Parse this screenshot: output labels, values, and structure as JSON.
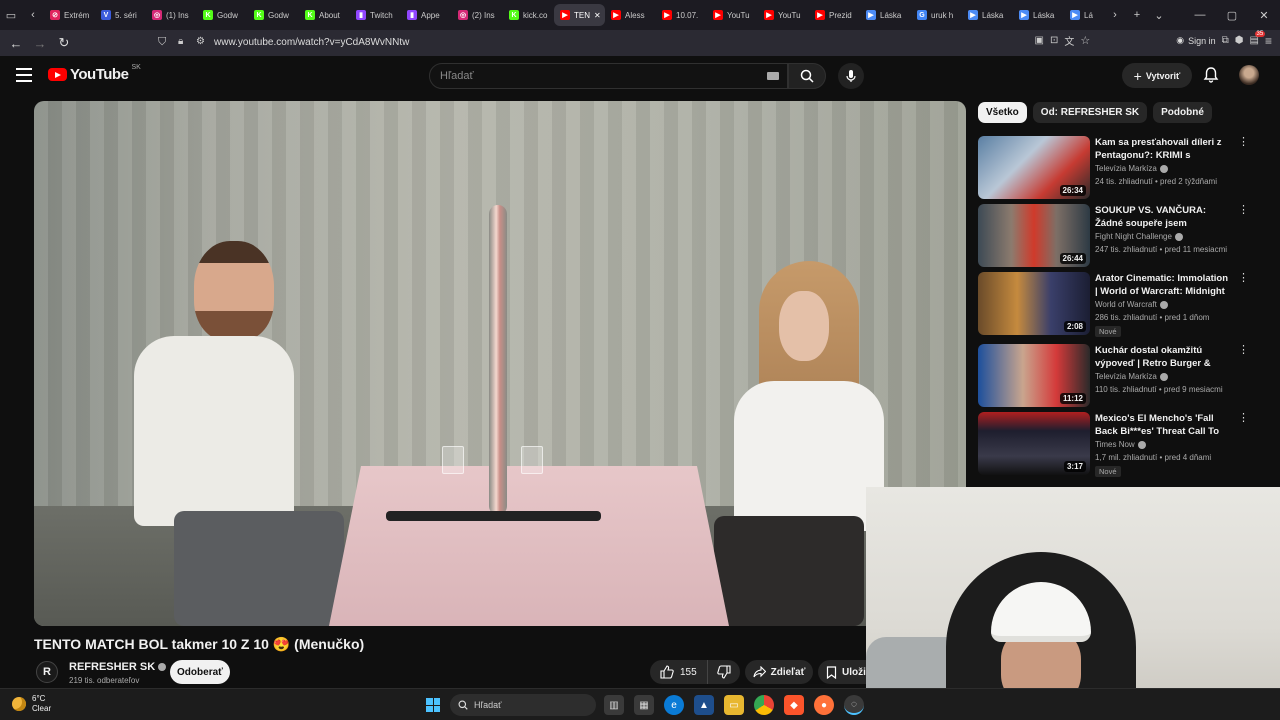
{
  "browser": {
    "tabs": [
      {
        "label": "Extrém",
        "color": "#e0245e",
        "glyph": "⊘"
      },
      {
        "label": "5. séri",
        "color": "#3b5bdb",
        "glyph": "V"
      },
      {
        "label": "(1) Ins",
        "color": "#d62976",
        "glyph": "◎"
      },
      {
        "label": "Godw",
        "color": "#53fc18",
        "glyph": "K"
      },
      {
        "label": "Godw",
        "color": "#53fc18",
        "glyph": "K"
      },
      {
        "label": "About",
        "color": "#53fc18",
        "glyph": "K"
      },
      {
        "label": "Twitch",
        "color": "#9146ff",
        "glyph": "▮"
      },
      {
        "label": "Appe",
        "color": "#9146ff",
        "glyph": "▮"
      },
      {
        "label": "(2) Ins",
        "color": "#d62976",
        "glyph": "◎"
      },
      {
        "label": "kick.co",
        "color": "#53fc18",
        "glyph": "K"
      },
      {
        "label": "TEN",
        "color": "#ff0000",
        "glyph": "▶",
        "active": true
      },
      {
        "label": "Aless",
        "color": "#ff0000",
        "glyph": "▶"
      },
      {
        "label": "10.07.",
        "color": "#ff0000",
        "glyph": "▶"
      },
      {
        "label": "YouTu",
        "color": "#ff0000",
        "glyph": "▶"
      },
      {
        "label": "YouTu",
        "color": "#ff0000",
        "glyph": "▶"
      },
      {
        "label": "Prezid",
        "color": "#ff0000",
        "glyph": "▶"
      },
      {
        "label": "Láska",
        "color": "#4c8bf5",
        "glyph": "▶"
      },
      {
        "label": "uruk h",
        "color": "#4285f4",
        "glyph": "G"
      },
      {
        "label": "Láska",
        "color": "#4c8bf5",
        "glyph": "▶"
      },
      {
        "label": "Láska",
        "color": "#4c8bf5",
        "glyph": "▶"
      },
      {
        "label": "Lá",
        "color": "#4c8bf5",
        "glyph": "▶"
      }
    ],
    "url": "www.youtube.com/watch?v=yCdA8WvNNtw",
    "sign_in": "Sign in",
    "ext_badge": "35"
  },
  "youtube": {
    "logo_text": "YouTube",
    "country": "SK",
    "search_placeholder": "Hľadať",
    "create_label": "Vytvoriť"
  },
  "video": {
    "title": "TENTO MATCH BOL takmer 10 Z 10 😍 (Menučko)",
    "channel_initial": "R",
    "channel_name": "REFRESHER SK",
    "subscribers": "219 tis. odberateľov",
    "subscribe_label": "Odoberať",
    "likes": "155",
    "share_label": "Zdieľať",
    "save_label": "Uložiť"
  },
  "chips": [
    "Všetko",
    "Od: REFRESHER SK",
    "Podobné"
  ],
  "recommendations": [
    {
      "title": "Kam sa presťahovali díleri z Pentagonu?: KRIMI s Kristínou...",
      "channel": "Televízia Markíza",
      "meta": "24 tis. zhliadnutí • pred 2 týždňami",
      "duration": "26:34",
      "badge": "",
      "thumb": "linear-gradient(135deg,#5a7fa3 0%,#b9c7d6 40%,#c63b32 70%,#2a2a2a 100%)"
    },
    {
      "title": "SOUKUP VS. VANČURA: Žádné soupeře jsem neuplácel ...",
      "channel": "Fight Night Challenge",
      "meta": "247 tis. zhliadnutí • pred 11 mesiacmi",
      "duration": "26:44",
      "badge": "",
      "thumb": "linear-gradient(90deg,#3d4a55 0%,#8c7b6e 30%,#d03a2b 50%,#7d6f66 70%,#2d3a44 100%)"
    },
    {
      "title": "Arator Cinematic: Immolation | World of Warcraft: Midnight",
      "channel": "World of Warcraft",
      "meta": "286 tis. zhliadnutí • pred 1 dňom",
      "duration": "2:08",
      "badge": "Nové",
      "thumb": "linear-gradient(90deg,#6a4b2a 0%,#c58a3e 35%,#3a3f6a 65%,#1b1e33 100%)"
    },
    {
      "title": "Kuchár dostal okamžitú výpoveď | Retro Burger & Dinn...",
      "channel": "Televízia Markíza",
      "meta": "110 tis. zhliadnutí • pred 9 mesiacmi",
      "duration": "11:12",
      "badge": "",
      "thumb": "linear-gradient(90deg,#1d4f9c 0%,#c9a58e 40%,#d43a3a 70%,#2a2a2a 100%)"
    },
    {
      "title": "Mexico's El Mencho's 'Fall Back Bi***es' Threat Call To Cops ...",
      "channel": "Times Now",
      "meta": "1,7 mil. zhliadnutí • pred 4 dňami",
      "duration": "3:17",
      "badge": "Nové",
      "thumb": "linear-gradient(180deg,#b01f1f 0%,#1e1e2e 30%,#3a3a4a 70%,#111 100%)"
    }
  ],
  "taskbar": {
    "temperature": "6°C",
    "condition": "Clear",
    "search_placeholder": "Hľadať"
  }
}
